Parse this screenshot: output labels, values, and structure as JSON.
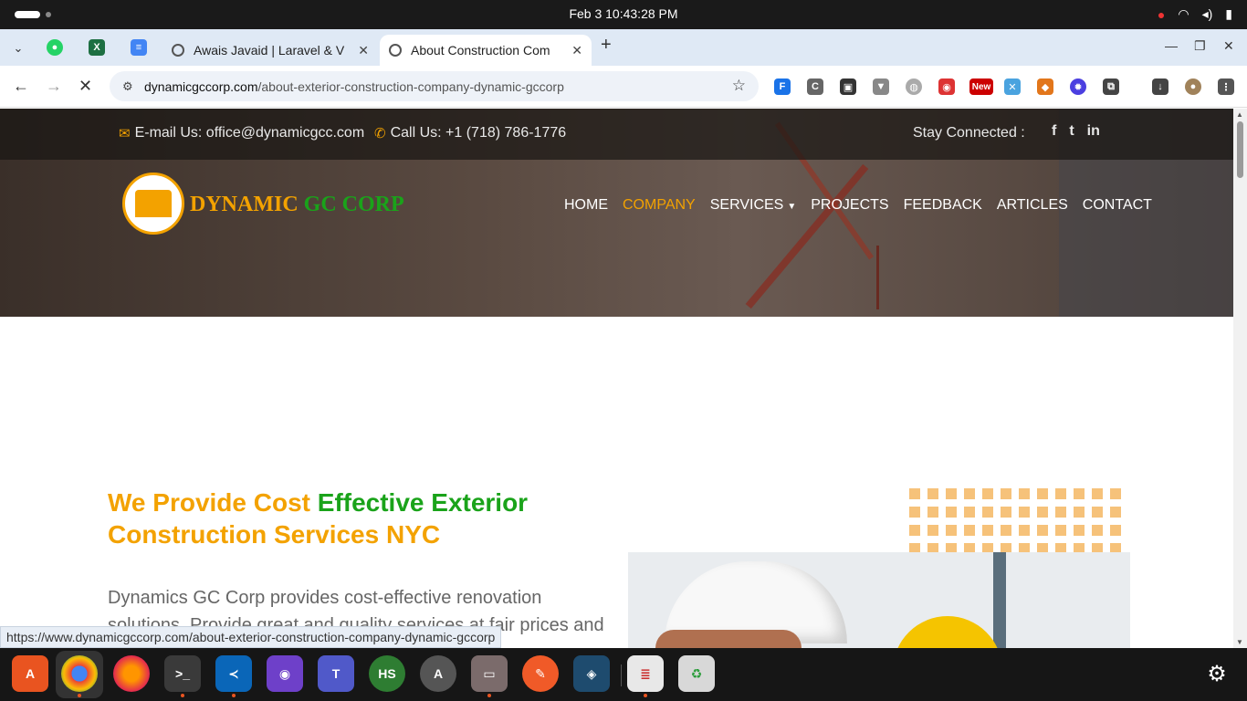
{
  "system": {
    "clock": "Feb 3  10:43:28 PM"
  },
  "browser": {
    "tabs": [
      {
        "title": "Awais Javaid | Laravel & V"
      },
      {
        "title": "About Construction Com"
      }
    ],
    "url": {
      "host": "dynamicgccorp.com",
      "path": "/about-exterior-construction-company-dynamic-gccorp"
    },
    "status_url": "https://www.dynamicgccorp.com/about-exterior-construction-company-dynamic-gccorp",
    "new_badge": "New"
  },
  "site": {
    "email": "E-mail Us: office@dynamicgcc.com",
    "phone": "Call Us: +1 (718) 786-1776",
    "stay": "Stay Connected :",
    "social": [
      "f",
      "t",
      "in"
    ],
    "brand": {
      "part1": "DYNAMIC",
      "part2": "GC CORP"
    },
    "nav": [
      "HOME",
      "COMPANY",
      "SERVICES",
      "PROJECTS",
      "FEEDBACK",
      "ARTICLES",
      "CONTACT"
    ],
    "heading": {
      "part1": "We Provide Cost ",
      "part2": "Effective Exterior",
      "part3": "Construction Services NYC"
    },
    "body": "Dynamics GC Corp provides cost-effective renovation solutions. Provide great and quality services at fair prices and"
  },
  "colors": {
    "accent_orange": "#f3a200",
    "accent_green": "#1aa31a"
  }
}
